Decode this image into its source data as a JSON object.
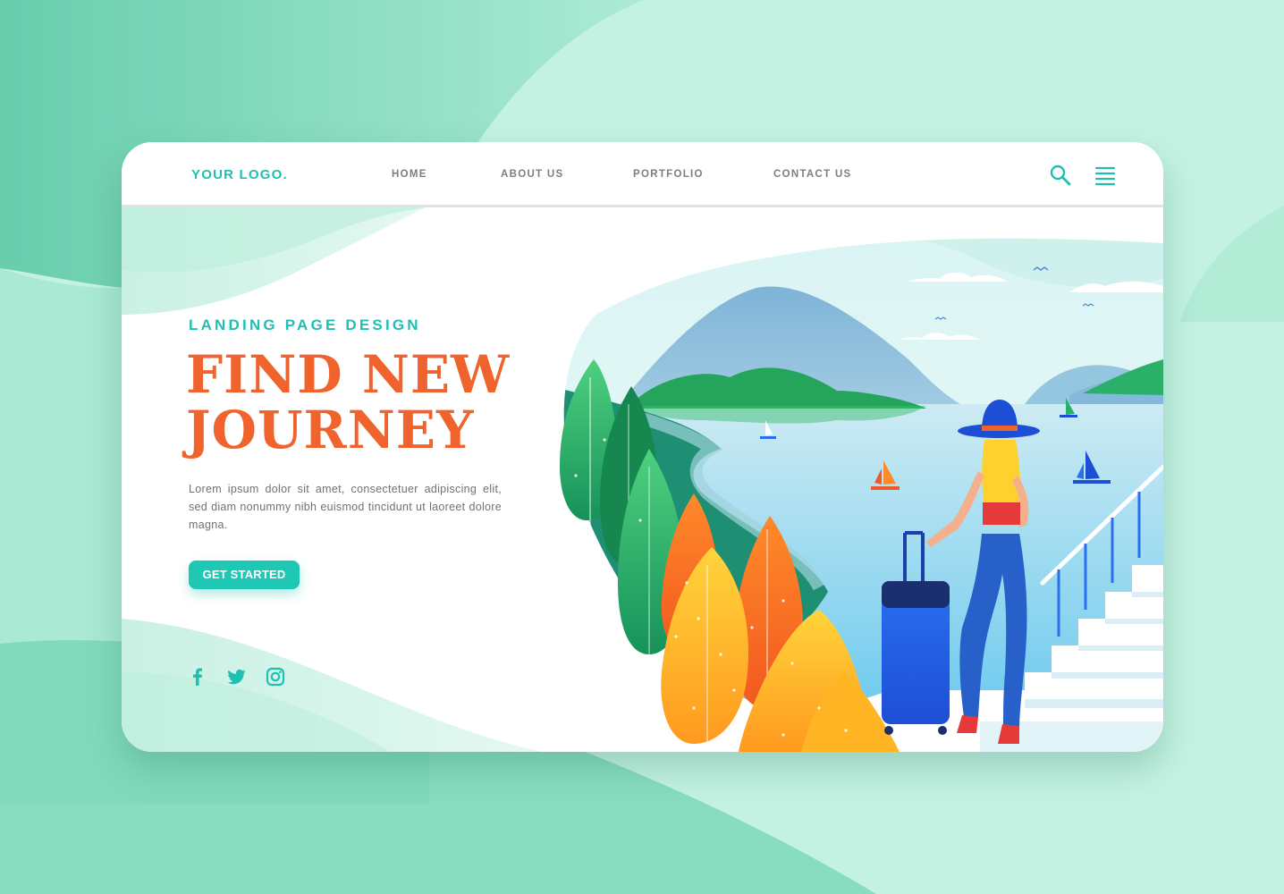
{
  "header": {
    "logo": "YOUR LOGO.",
    "nav": [
      "HOME",
      "ABOUT US",
      "PORTFOLIO",
      "CONTACT US"
    ],
    "icons": [
      "search-icon",
      "hamburger-menu-icon"
    ]
  },
  "hero": {
    "subtitle": "LANDING PAGE DESIGN",
    "title_line1": "FIND NEW",
    "title_line2": "JOURNEY",
    "description": "Lorem ipsum dolor sit amet, consectetuer adipiscing elit, sed diam nonummy nibh euismod tincidunt ut laoreet dolore magna.",
    "cta": "GET STARTED"
  },
  "social": [
    "facebook-icon",
    "twitter-icon",
    "instagram-icon"
  ],
  "colors": {
    "accent": "#1fbfb1",
    "title": "#f0632d",
    "text": "#6d7275",
    "background": "#bff0dd"
  }
}
